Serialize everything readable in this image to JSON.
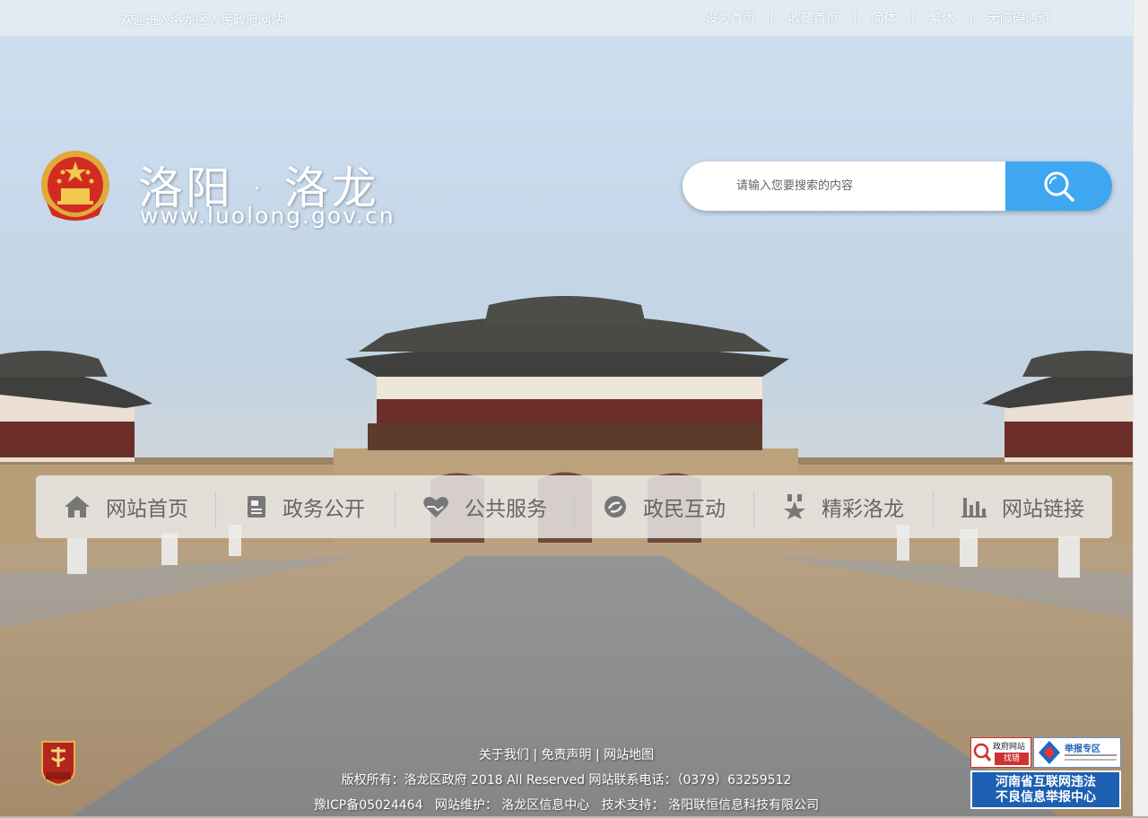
{
  "topbar": {
    "welcome": "欢迎进入洛龙区人民政府网站！",
    "links": [
      "设为首页",
      "收藏首页",
      "简体",
      "繁体",
      "无障碍通道"
    ],
    "separator": "|"
  },
  "logo": {
    "title": "洛阳 · 洛龙",
    "url": "www.luolong.gov.cn"
  },
  "search": {
    "placeholder": "请输入您要搜索的内容",
    "icon": "search-icon",
    "button_color": "#3fa7f1"
  },
  "nav": [
    {
      "label": "网站首页",
      "icon": "home-icon"
    },
    {
      "label": "政务公开",
      "icon": "document-icon"
    },
    {
      "label": "公共服务",
      "icon": "heart-hand-icon"
    },
    {
      "label": "政民互动",
      "icon": "interaction-icon"
    },
    {
      "label": "精彩洛龙",
      "icon": "star-medal-icon"
    },
    {
      "label": "网站链接",
      "icon": "bar-chart-icon"
    }
  ],
  "footer": {
    "links": [
      "关于我们",
      "免责声明",
      "网站地图"
    ],
    "copyright": "版权所有：洛龙区政府 2018 All Reserved 网站联系电话：（0379）63259512",
    "icp": "豫ICP备05024464",
    "maintain": "网站维护： 洛龙区信息中心",
    "support": "技术支持： 洛阳联恒信息科技有限公司"
  },
  "badges": {
    "find_error_top": "政府网站",
    "find_error_bottom": "找错",
    "report_zone": "举报专区",
    "report_line1": "河南省互联网违法",
    "report_line2": "不良信息举报中心"
  }
}
